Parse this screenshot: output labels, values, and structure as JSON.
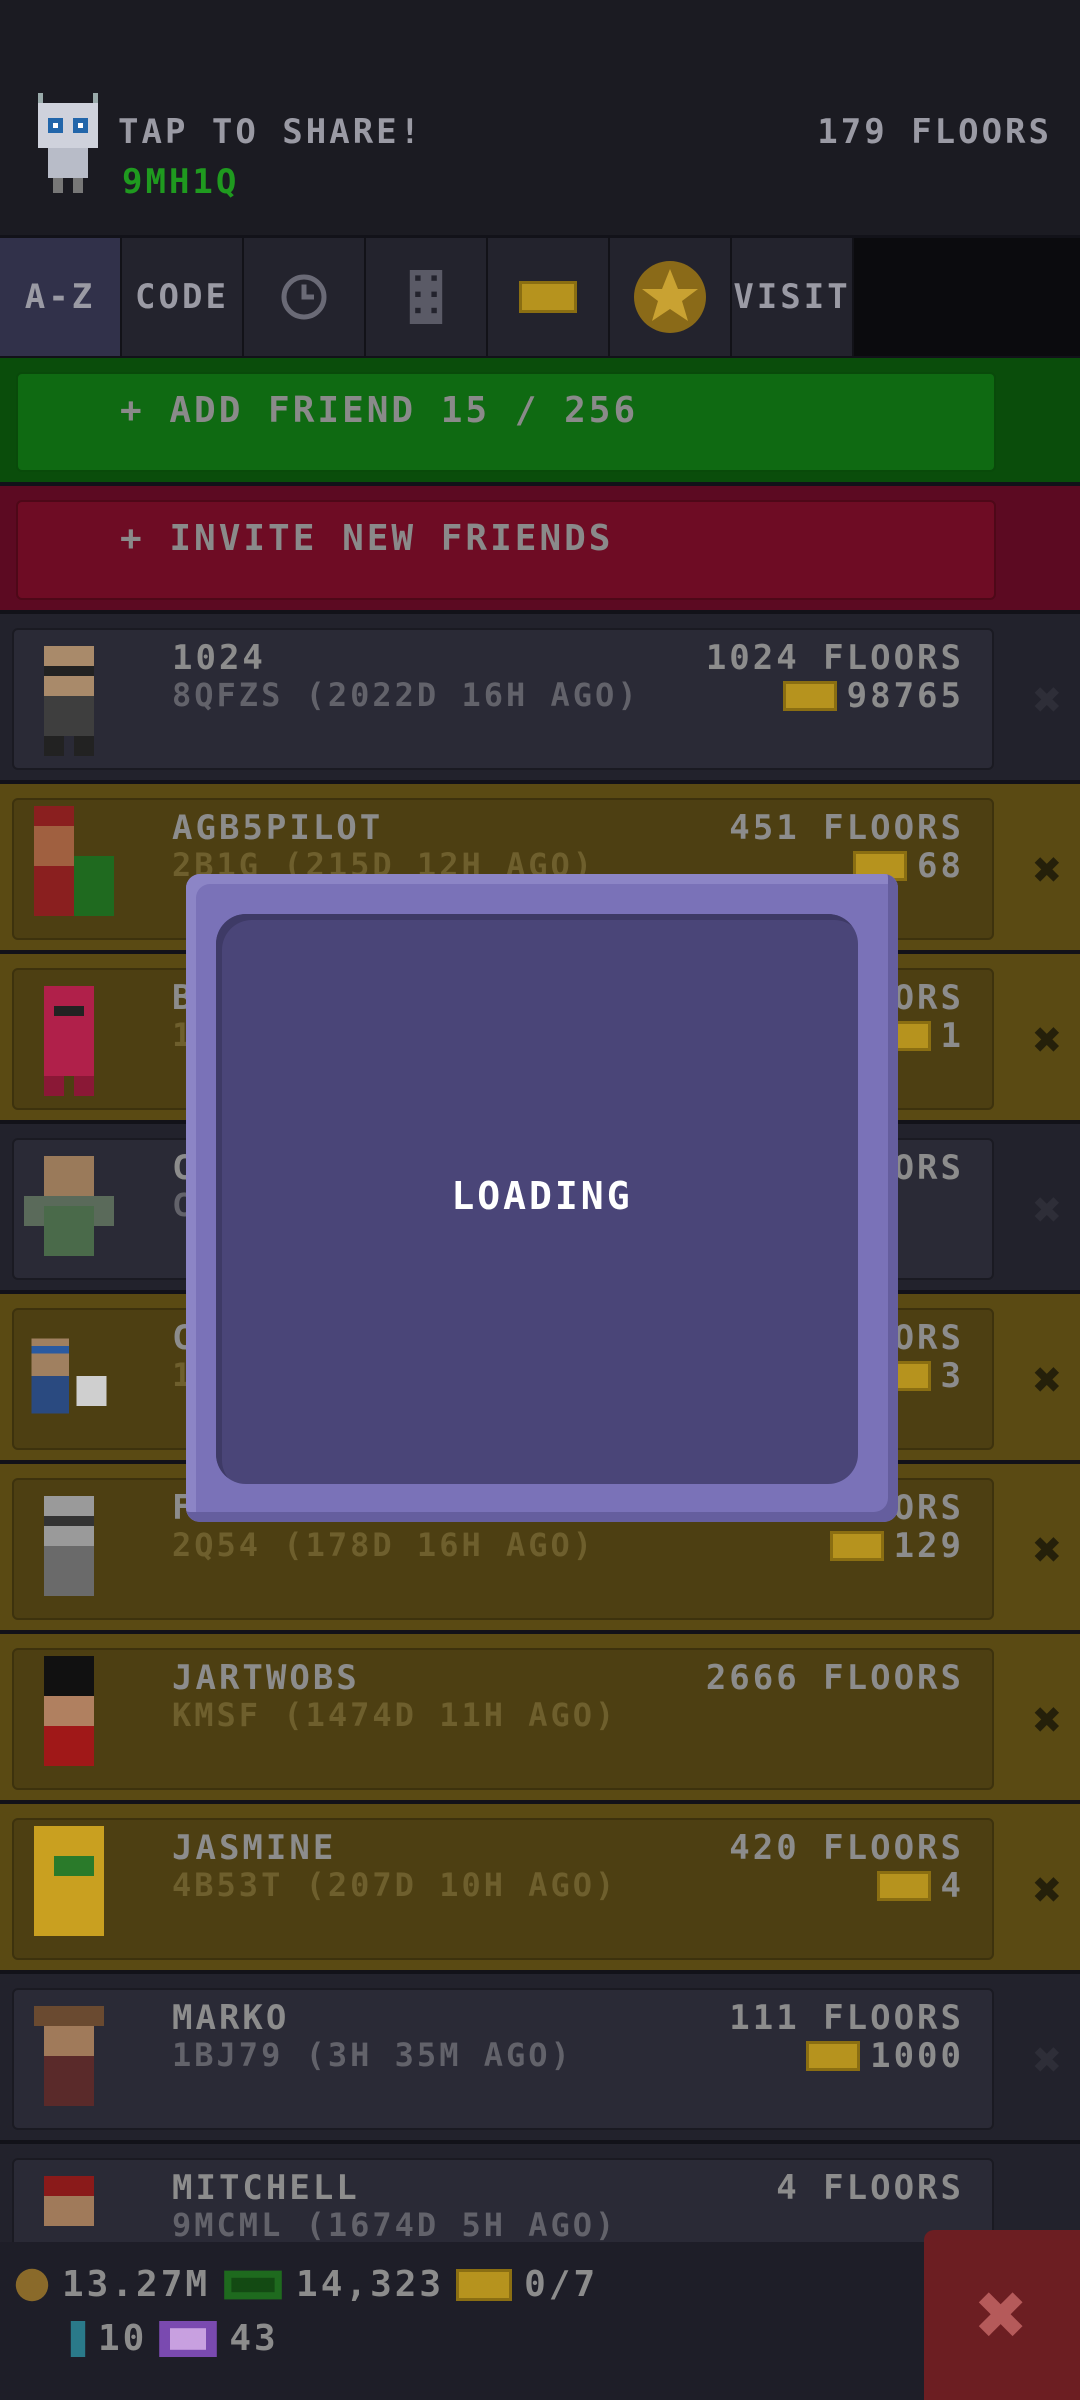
{
  "header": {
    "share": "TAP TO SHARE!",
    "code": "9MH1Q",
    "floors": "179 FLOORS"
  },
  "tabs": [
    "A-Z",
    "CODE",
    "",
    "",
    "",
    "",
    "VISIT"
  ],
  "add_friend": "+ ADD FRIEND 15 / 256",
  "invite": "+ INVITE NEW FRIENDS",
  "friends": [
    {
      "name": "1024",
      "sub": "8QFZS (2022D 16H AGO)",
      "floors": "1024 FLOORS",
      "bux": "98765",
      "style": "dark"
    },
    {
      "name": "AGB5PILOT",
      "sub": "2B1G (215D 12H AGO)",
      "floors": "451 FLOORS",
      "bux": "68",
      "style": "gold"
    },
    {
      "name": "B",
      "sub": "1",
      "floors": "ORS",
      "bux": "1",
      "style": "gold"
    },
    {
      "name": "C",
      "sub": "C",
      "floors": "ORS",
      "bux": "",
      "style": "dark"
    },
    {
      "name": "C",
      "sub": "1",
      "floors": "ORS",
      "bux": "3",
      "style": "gold"
    },
    {
      "name": "FR",
      "sub": "2Q54 (178D 16H AGO)",
      "floors": "OORS",
      "bux": "129",
      "style": "gold"
    },
    {
      "name": "JARTWOBS",
      "sub": "KMSF (1474D 11H AGO)",
      "floors": "2666 FLOORS",
      "bux": "",
      "style": "gold"
    },
    {
      "name": "JASMINE",
      "sub": "4B53T (207D 10H AGO)",
      "floors": "420 FLOORS",
      "bux": "4",
      "style": "gold"
    },
    {
      "name": "MARKO",
      "sub": "1BJ79 (3H 35M AGO)",
      "floors": "111 FLOORS",
      "bux": "1000",
      "style": "dark"
    },
    {
      "name": "MITCHELL",
      "sub": "9MCML (1674D 5H AGO)",
      "floors": "4 FLOORS",
      "bux": "",
      "style": "dark"
    }
  ],
  "footer": {
    "coins": "13.27M",
    "bux": "14,323",
    "tickets": "0/7",
    "keys": "10",
    "points": "43"
  },
  "dialog": {
    "text": "LOADING"
  },
  "colors": {
    "green": "#0e6b10",
    "red": "#7c0e2a",
    "dialog": "#7a72b8"
  }
}
